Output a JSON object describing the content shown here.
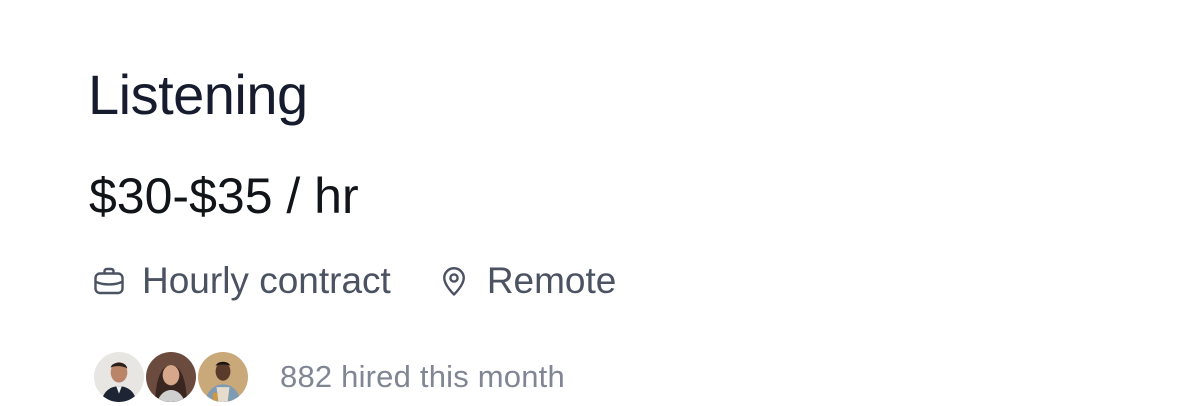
{
  "job": {
    "title": "Listening",
    "rate": "$30-$35 / hr",
    "meta": [
      {
        "icon": "briefcase-icon",
        "label": "Hourly contract"
      },
      {
        "icon": "location-pin-icon",
        "label": "Remote"
      }
    ],
    "social_proof": {
      "text": "882 hired this month",
      "avatars": [
        "avatar-1",
        "avatar-2",
        "avatar-3"
      ]
    }
  },
  "colors": {
    "title": "#161b2e",
    "rate": "#111418",
    "meta_text": "#4b5262",
    "muted_text": "#808693",
    "background": "#ffffff"
  }
}
